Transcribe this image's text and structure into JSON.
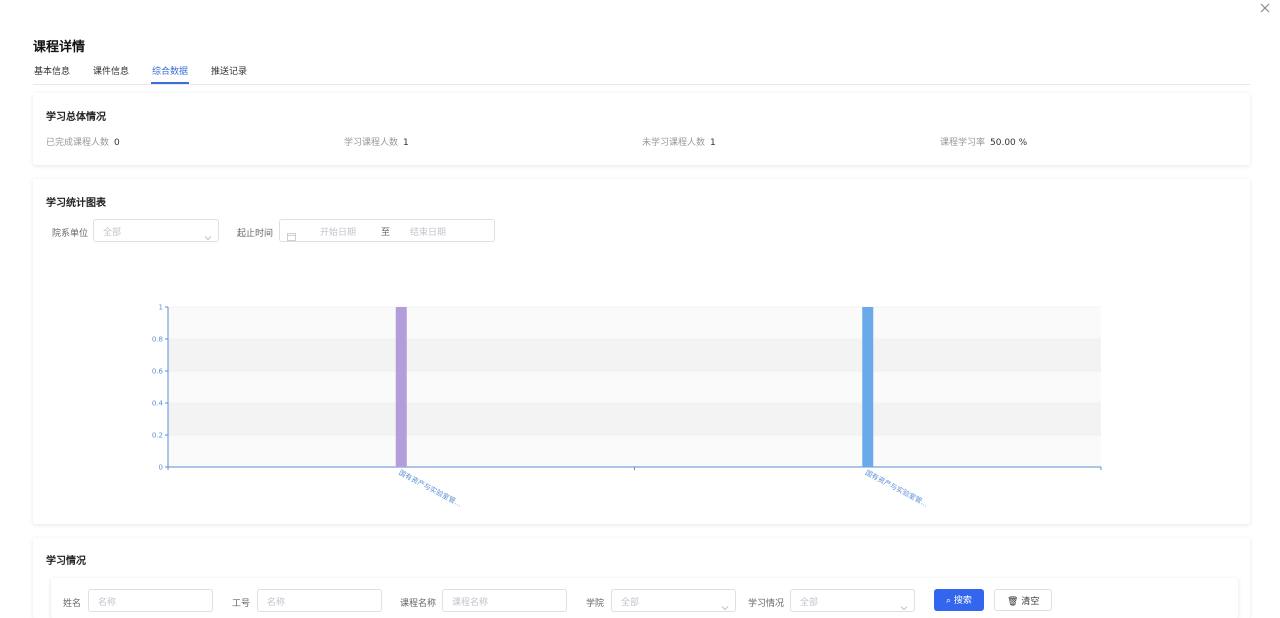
{
  "dialog": {
    "title": "课程详情",
    "close_icon": "close-icon"
  },
  "tabs": [
    {
      "label": "基本信息",
      "active": false
    },
    {
      "label": "课件信息",
      "active": false
    },
    {
      "label": "综合数据",
      "active": true
    },
    {
      "label": "推送记录",
      "active": false
    }
  ],
  "summary": {
    "title": "学习总体情况",
    "stats": [
      {
        "label": "已完成课程人数",
        "value": "0"
      },
      {
        "label": "学习课程人数",
        "value": "1"
      },
      {
        "label": "未学习课程人数",
        "value": "1"
      },
      {
        "label": "课程学习率",
        "value": "50.00 %"
      }
    ]
  },
  "stats_chart": {
    "title": "学习统计图表",
    "filters": {
      "dept_label": "院系单位",
      "dept_placeholder": "全部",
      "time_label": "起止时间",
      "start_placeholder": "开始日期",
      "range_sep": "至",
      "end_placeholder": "结束日期"
    }
  },
  "chart_data": {
    "type": "bar",
    "categories": [
      "国有资产与实验室管…",
      "国有资产与实验室管…"
    ],
    "values": [
      1,
      1
    ],
    "bar_colors": [
      "#b39ddb",
      "#6aaaea"
    ],
    "ylim": [
      0,
      1
    ],
    "yticks": [
      "0",
      "0.2",
      "0.4",
      "0.6",
      "0.8",
      "1"
    ],
    "grid": true
  },
  "study": {
    "title": "学习情况",
    "filters": {
      "name_label": "姓名",
      "name_placeholder": "名称",
      "id_label": "工号",
      "id_placeholder": "名称",
      "course_label": "课程名称",
      "course_placeholder": "课程名称",
      "college_label": "学院",
      "college_placeholder": "全部",
      "status_label": "学习情况",
      "status_placeholder": "全部",
      "search_label": "搜索",
      "clear_label": "清空"
    }
  }
}
